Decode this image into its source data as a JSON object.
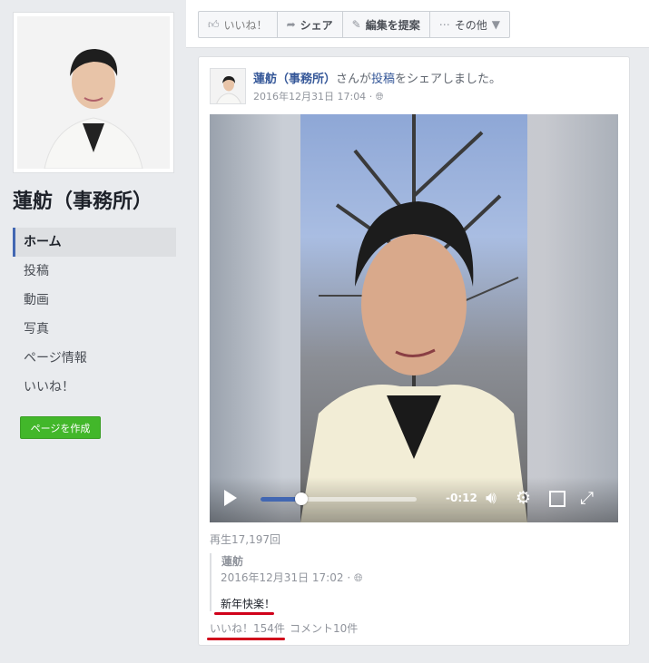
{
  "page": {
    "name": "蓮舫（事務所）",
    "create_page_label": "ページを作成"
  },
  "nav": [
    {
      "label": "ホーム",
      "active": true
    },
    {
      "label": "投稿",
      "active": false
    },
    {
      "label": "動画",
      "active": false
    },
    {
      "label": "写真",
      "active": false
    },
    {
      "label": "ページ情報",
      "active": false
    },
    {
      "label": "いいね！",
      "active": false
    }
  ],
  "actions": {
    "like": "いいね！",
    "share": "シェア",
    "suggest_edit": "編集を提案",
    "more": "その他"
  },
  "post": {
    "author": "蓮舫（事務所）",
    "action_middle": "さんが",
    "action_link": "投稿",
    "action_suffix": "をシェアしました。",
    "timestamp": "2016年12月31日 17:04",
    "view_count": "再生17,197回",
    "video": {
      "time_remaining": "-0:12",
      "progress": 0.26
    },
    "original": {
      "author": "蓮舫",
      "timestamp": "2016年12月31日 17:02",
      "text": "新年快楽！"
    },
    "likes": "いいね！154件",
    "comments": "コメント10件"
  },
  "colors": {
    "accent": "#4267b2",
    "link": "#365899",
    "create_button": "#42b72a",
    "underline": "#d0021b"
  }
}
